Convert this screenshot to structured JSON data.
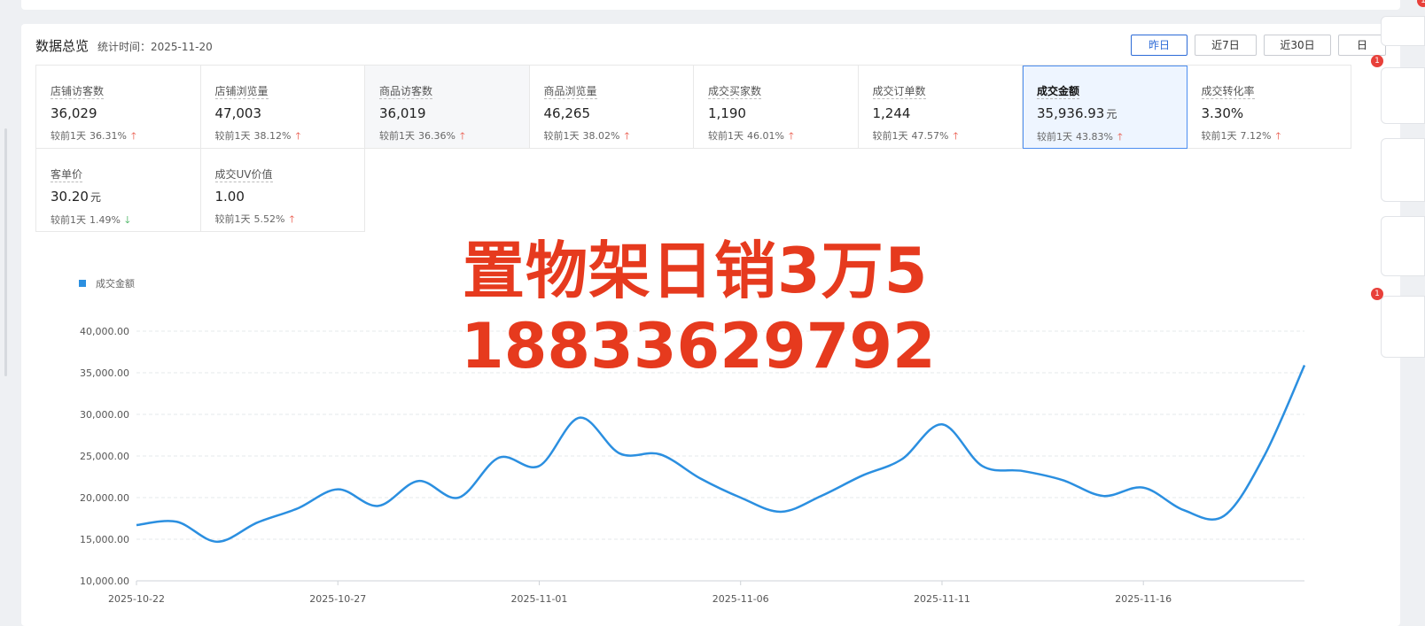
{
  "panel": {
    "title": "数据总览",
    "stat_time": "统计时间：2025-11-20"
  },
  "range_buttons": [
    {
      "label": "昨日",
      "active": true
    },
    {
      "label": "近7日",
      "active": false
    },
    {
      "label": "近30日",
      "active": false
    },
    {
      "label": "日",
      "active": false
    }
  ],
  "metrics": [
    {
      "label": "店铺访客数",
      "value": "36,029",
      "unit": "",
      "compare_label": "较前1天",
      "compare_pct": "36.31%",
      "trend": "up"
    },
    {
      "label": "店铺浏览量",
      "value": "47,003",
      "unit": "",
      "compare_label": "较前1天",
      "compare_pct": "38.12%",
      "trend": "up"
    },
    {
      "label": "商品访客数",
      "value": "36,019",
      "unit": "",
      "compare_label": "较前1天",
      "compare_pct": "36.36%",
      "trend": "up"
    },
    {
      "label": "商品浏览量",
      "value": "46,265",
      "unit": "",
      "compare_label": "较前1天",
      "compare_pct": "38.02%",
      "trend": "up"
    },
    {
      "label": "成交买家数",
      "value": "1,190",
      "unit": "",
      "compare_label": "较前1天",
      "compare_pct": "46.01%",
      "trend": "up"
    },
    {
      "label": "成交订单数",
      "value": "1,244",
      "unit": "",
      "compare_label": "较前1天",
      "compare_pct": "47.57%",
      "trend": "up"
    },
    {
      "label": "成交金额",
      "value": "35,936.93",
      "unit": "元",
      "compare_label": "较前1天",
      "compare_pct": "43.83%",
      "trend": "up"
    },
    {
      "label": "成交转化率",
      "value": "3.30%",
      "unit": "",
      "compare_label": "较前1天",
      "compare_pct": "7.12%",
      "trend": "up"
    },
    {
      "label": "客单价",
      "value": "30.20",
      "unit": "元",
      "compare_label": "较前1天",
      "compare_pct": "1.49%",
      "trend": "down"
    },
    {
      "label": "成交UV价值",
      "value": "1.00",
      "unit": "",
      "compare_label": "较前1天",
      "compare_pct": "5.52%",
      "trend": "up"
    }
  ],
  "overlay": {
    "line1": "置物架日销3万5",
    "line2": "18833629792"
  },
  "colors": {
    "accent": "#2d6bd7",
    "series": "#2b8fe0",
    "up": "#e84c3d",
    "down": "#2aa848",
    "overlay": "#e63a1e"
  },
  "right_rail": {
    "badges": [
      "1",
      "1",
      "1"
    ]
  },
  "chart_data": {
    "type": "line",
    "legend": [
      "成交金额"
    ],
    "legend_position": "top-left",
    "grid": true,
    "ylim": [
      10000,
      40000
    ],
    "yticks": [
      "10,000.00",
      "15,000.00",
      "20,000.00",
      "25,000.00",
      "30,000.00",
      "35,000.00",
      "40,000.00"
    ],
    "xticks": [
      "2025-10-22",
      "2025-10-27",
      "2025-11-01",
      "2025-11-06",
      "2025-11-11",
      "2025-11-16"
    ],
    "x": [
      "2025-10-22",
      "2025-10-23",
      "2025-10-24",
      "2025-10-25",
      "2025-10-26",
      "2025-10-27",
      "2025-10-28",
      "2025-10-29",
      "2025-10-30",
      "2025-10-31",
      "2025-11-01",
      "2025-11-02",
      "2025-11-03",
      "2025-11-04",
      "2025-11-05",
      "2025-11-06",
      "2025-11-07",
      "2025-11-08",
      "2025-11-09",
      "2025-11-10",
      "2025-11-11",
      "2025-11-12",
      "2025-11-13",
      "2025-11-14",
      "2025-11-15",
      "2025-11-16",
      "2025-11-17",
      "2025-11-18",
      "2025-11-19",
      "2025-11-20"
    ],
    "series": [
      {
        "name": "成交金额",
        "values": [
          16700,
          17100,
          14700,
          17000,
          18700,
          21000,
          19000,
          22000,
          20000,
          24800,
          23800,
          29600,
          25300,
          25200,
          22300,
          20000,
          18300,
          20200,
          22600,
          24600,
          28800,
          23800,
          23200,
          22100,
          20200,
          21200,
          18500,
          17800,
          25000,
          35900
        ]
      }
    ]
  }
}
